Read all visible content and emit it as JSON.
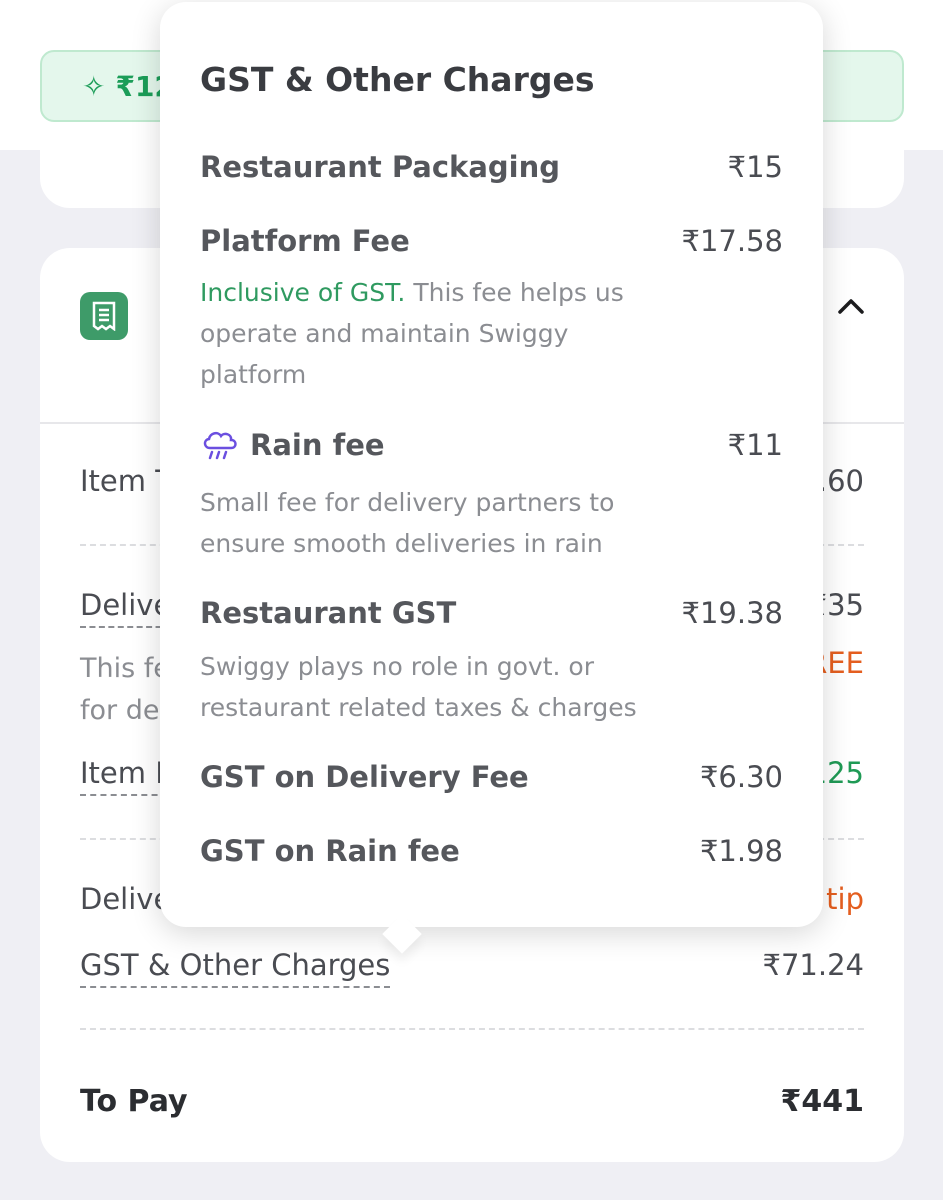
{
  "banner": {
    "savings_text": "₹12"
  },
  "bill": {
    "rows": [
      {
        "label": "Item T",
        "value": ".60"
      },
      {
        "label": "Delive",
        "value": "₹35",
        "note_line1": "This fe",
        "note_line2": "for de",
        "note_value": "REE"
      },
      {
        "label": "Item D",
        "value": "125"
      },
      {
        "label": "Delive",
        "value": "tip"
      }
    ],
    "gst_label": "GST & Other Charges",
    "gst_value": "₹71.24",
    "to_pay_label": "To Pay",
    "to_pay_value": "₹441"
  },
  "popover": {
    "title": "GST & Other Charges",
    "items": [
      {
        "label": "Restaurant Packaging",
        "value": "₹15"
      },
      {
        "label": "Platform Fee",
        "value": "₹17.58",
        "desc_highlight": "Inclusive of GST.",
        "desc": " This fee helps us operate and maintain Swiggy platform"
      },
      {
        "label": "Rain fee",
        "value": "₹11",
        "desc": "Small fee for delivery partners to ensure smooth deliveries in rain"
      },
      {
        "label": "Restaurant GST",
        "value": "₹19.38",
        "desc": "Swiggy plays no role in govt. or restaurant related taxes & charges"
      },
      {
        "label": "GST on Delivery Fee",
        "value": "₹6.30"
      },
      {
        "label": "GST on Rain fee",
        "value": "₹1.98"
      }
    ]
  },
  "colors": {
    "accent_green": "#1f9a55",
    "accent_orange": "#e45e1f",
    "icon_purple": "#6b4fe0"
  },
  "icons": {
    "bill": "receipt-icon",
    "collapse": "chevron-up-icon",
    "rain": "rain-cloud-icon",
    "spark": "sparkle-icon"
  }
}
